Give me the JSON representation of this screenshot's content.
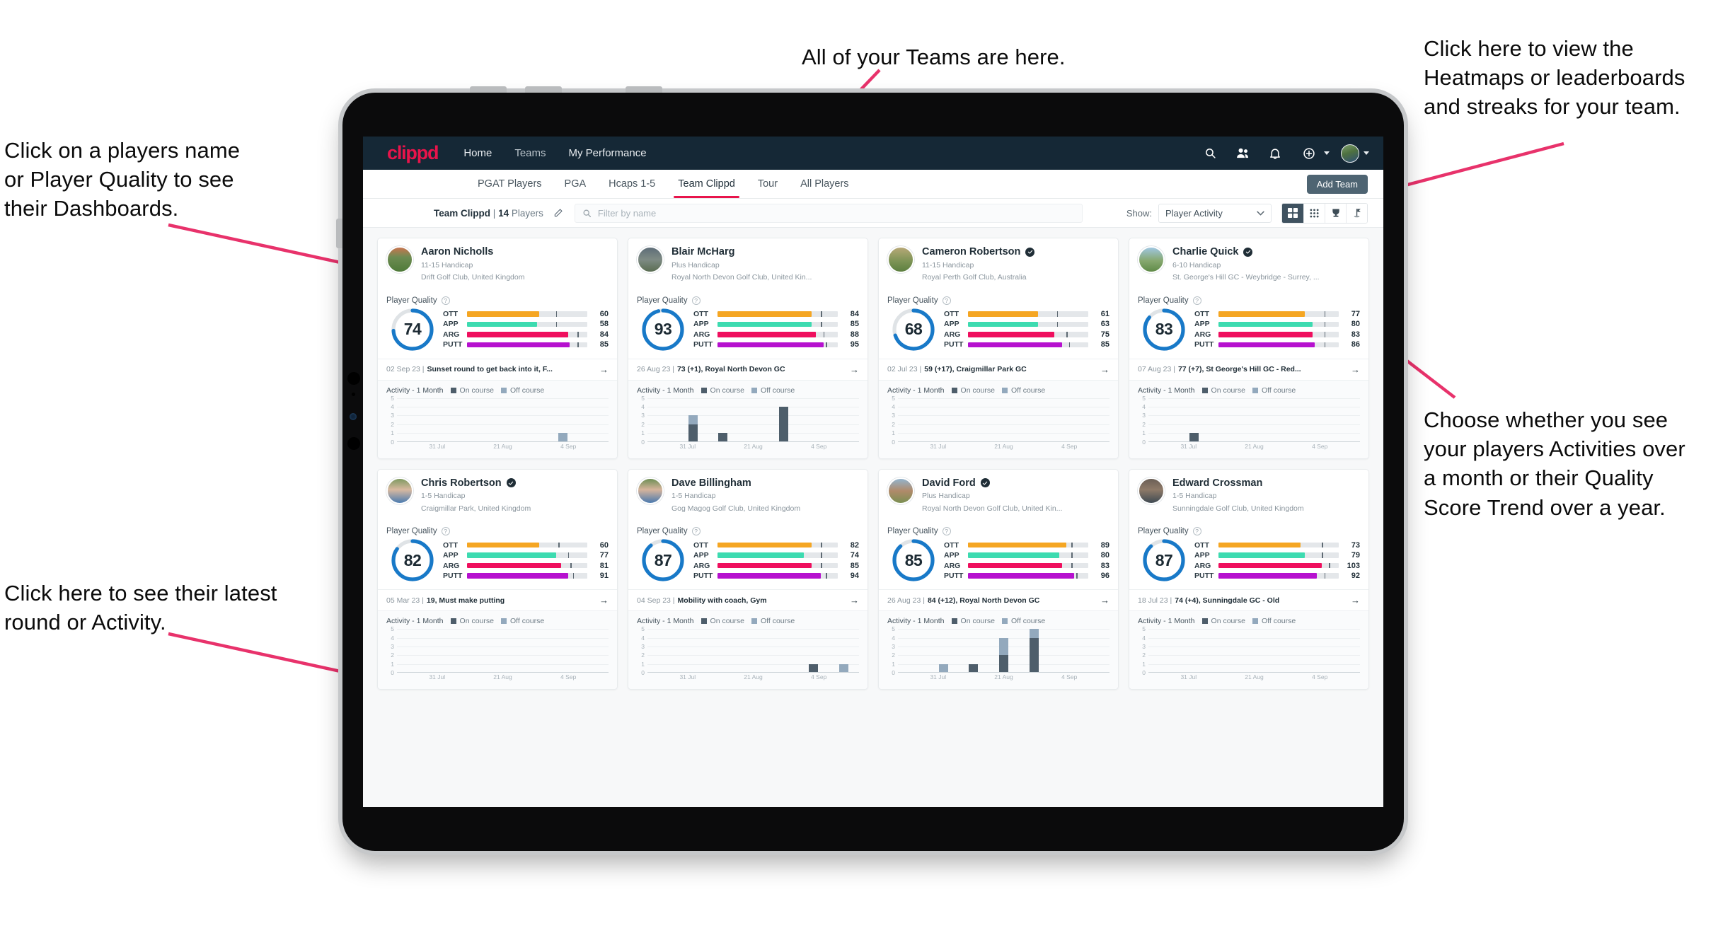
{
  "annotations": [
    {
      "id": "teams",
      "text": "All of your Teams are here."
    },
    {
      "id": "heatmaps",
      "text": "Click here to view the\nHeatmaps or leaderboards\nand streaks for your team."
    },
    {
      "id": "players-name",
      "text": "Click on a players name\nor Player Quality to see\ntheir Dashboards."
    },
    {
      "id": "activity-toggle",
      "text": "Choose whether you see\nyour players Activities over\na month or their Quality\nScore Trend over a year."
    },
    {
      "id": "latest-round",
      "text": "Click here to see their latest\nround or Activity."
    }
  ],
  "topnav": {
    "brand": "clippd",
    "links": [
      {
        "label": "Home",
        "active": true
      },
      {
        "label": "Teams",
        "active": false
      },
      {
        "label": "My Performance",
        "active": false
      }
    ],
    "icons": [
      "search-icon",
      "people-icon",
      "bell-icon",
      "plus-circle-icon",
      "avatar"
    ]
  },
  "subtabs": {
    "items": [
      {
        "label": "PGAT Players",
        "active": false
      },
      {
        "label": "PGA",
        "active": false
      },
      {
        "label": "Hcaps 1-5",
        "active": false
      },
      {
        "label": "Team Clippd",
        "active": true
      },
      {
        "label": "Tour",
        "active": false
      },
      {
        "label": "All Players",
        "active": false
      }
    ],
    "add_team_label": "Add Team"
  },
  "toolbar": {
    "team_name": "Team Clippd",
    "separator": "|",
    "player_count": "14",
    "players_word": "Players",
    "edit_icon": "pencil-icon",
    "search_placeholder": "Filter by name",
    "show_label": "Show:",
    "show_value": "Player Activity",
    "show_options": [
      "Player Activity",
      "Quality Score Trend"
    ],
    "views": [
      {
        "name": "grid-view",
        "icon": "grid-icon",
        "active": true
      },
      {
        "name": "compact-view",
        "icon": "dots-grid-icon",
        "active": false
      },
      {
        "name": "leaderboard-view",
        "icon": "trophy-icon",
        "active": false
      },
      {
        "name": "heatmap-view",
        "icon": "golf-flag-icon",
        "active": false
      }
    ]
  },
  "card_labels": {
    "quality_title": "Player Quality",
    "help_icon": "question-icon",
    "activity_title": "Activity - 1 Month",
    "legend_on": "On course",
    "legend_off": "Off course",
    "arrow_icon": "arrow-right-icon"
  },
  "colors": {
    "accent": "#e8144b",
    "navbar": "#152836",
    "ott": "#f5a623",
    "app": "#3ddbb0",
    "arg": "#ef0f5e",
    "putt": "#b611cf",
    "ring": "#1879c8",
    "ring_track": "#dfe3e6",
    "on_course": "#4e5e6b",
    "off_course": "#93a9bd"
  },
  "chart_data": {
    "type": "bar",
    "title": "Activity - 1 Month",
    "series_names": [
      "On course",
      "Off course"
    ],
    "categories": [
      "31 Jul",
      "21 Aug",
      "4 Sep"
    ],
    "ylim": [
      0,
      5
    ],
    "yticks": [
      0,
      1,
      2,
      3,
      4,
      5
    ],
    "xlabel": "",
    "ylabel": "",
    "grid": true,
    "legend_position": "top",
    "per_player": [
      {
        "player": "Aaron Nicholls",
        "bins": [
          [
            0,
            0
          ],
          [
            0,
            0
          ],
          [
            0,
            0
          ],
          [
            0,
            0
          ],
          [
            0,
            0
          ],
          [
            0,
            1
          ],
          [
            0,
            0
          ]
        ]
      },
      {
        "player": "Blair McHarg",
        "bins": [
          [
            0,
            0
          ],
          [
            2,
            1
          ],
          [
            1,
            0
          ],
          [
            0,
            0
          ],
          [
            4,
            0
          ],
          [
            0,
            0
          ],
          [
            0,
            0
          ]
        ]
      },
      {
        "player": "Cameron Robertson",
        "bins": [
          [
            0,
            0
          ],
          [
            0,
            0
          ],
          [
            0,
            0
          ],
          [
            0,
            0
          ],
          [
            0,
            0
          ],
          [
            0,
            0
          ],
          [
            0,
            0
          ]
        ]
      },
      {
        "player": "Charlie Quick",
        "bins": [
          [
            0,
            0
          ],
          [
            1,
            0
          ],
          [
            0,
            0
          ],
          [
            0,
            0
          ],
          [
            0,
            0
          ],
          [
            0,
            0
          ],
          [
            0,
            0
          ]
        ]
      },
      {
        "player": "Chris Robertson",
        "bins": [
          [
            0,
            0
          ],
          [
            0,
            0
          ],
          [
            0,
            0
          ],
          [
            0,
            0
          ],
          [
            0,
            0
          ],
          [
            0,
            0
          ],
          [
            0,
            0
          ]
        ]
      },
      {
        "player": "Dave Billingham",
        "bins": [
          [
            0,
            0
          ],
          [
            0,
            0
          ],
          [
            0,
            0
          ],
          [
            0,
            0
          ],
          [
            0,
            0
          ],
          [
            1,
            0
          ],
          [
            0,
            1
          ]
        ]
      },
      {
        "player": "David Ford",
        "bins": [
          [
            0,
            0
          ],
          [
            0,
            1
          ],
          [
            1,
            0
          ],
          [
            2,
            2
          ],
          [
            4,
            1
          ],
          [
            0,
            0
          ],
          [
            0,
            0
          ]
        ]
      },
      {
        "player": "Edward Crossman",
        "bins": [
          [
            0,
            0
          ],
          [
            0,
            0
          ],
          [
            0,
            0
          ],
          [
            0,
            0
          ],
          [
            0,
            0
          ],
          [
            0,
            0
          ],
          [
            0,
            0
          ]
        ]
      }
    ]
  },
  "players": [
    {
      "name": "Aaron Nicholls",
      "verified": false,
      "handicap": "11-15 Handicap",
      "club": "Drift Golf Club, United Kingdom",
      "quality": 74,
      "ring_pct": 74,
      "bars": [
        {
          "label": "OTT",
          "value": 60,
          "fill": 60,
          "tick": 74
        },
        {
          "label": "APP",
          "value": 58,
          "fill": 58,
          "tick": 74
        },
        {
          "label": "ARG",
          "value": 84,
          "fill": 84,
          "tick": 92
        },
        {
          "label": "PUTT",
          "value": 85,
          "fill": 85,
          "tick": 92
        }
      ],
      "latest_date": "02 Sep 23",
      "latest_text": "Sunset round to get back into it, F...",
      "avatar_bg": "linear-gradient(180deg,#c8754f 0%,#6d8c52 40%,#4f7a39 100%)"
    },
    {
      "name": "Blair McHarg",
      "verified": false,
      "handicap": "Plus Handicap",
      "club": "Royal North Devon Golf Club, United Kin...",
      "quality": 93,
      "ring_pct": 96,
      "bars": [
        {
          "label": "OTT",
          "value": 84,
          "fill": 78,
          "tick": 86
        },
        {
          "label": "APP",
          "value": 85,
          "fill": 78,
          "tick": 86
        },
        {
          "label": "ARG",
          "value": 88,
          "fill": 82,
          "tick": 88
        },
        {
          "label": "PUTT",
          "value": 95,
          "fill": 88,
          "tick": 90
        }
      ],
      "latest_date": "26 Aug 23",
      "latest_text": "73 (+1), Royal North Devon GC",
      "avatar_bg": "linear-gradient(180deg,#5e6d78 0%,#7e8b84 50%,#5a6d52 100%)"
    },
    {
      "name": "Cameron Robertson",
      "verified": true,
      "handicap": "11-15 Handicap",
      "club": "Royal Perth Golf Club, Australia",
      "quality": 68,
      "ring_pct": 70,
      "bars": [
        {
          "label": "OTT",
          "value": 61,
          "fill": 58,
          "tick": 74
        },
        {
          "label": "APP",
          "value": 63,
          "fill": 58,
          "tick": 74
        },
        {
          "label": "ARG",
          "value": 75,
          "fill": 72,
          "tick": 82
        },
        {
          "label": "PUTT",
          "value": 85,
          "fill": 78,
          "tick": 84
        }
      ],
      "latest_date": "02 Jul 23",
      "latest_text": "59 (+17), Craigmillar Park GC",
      "avatar_bg": "linear-gradient(180deg,#b7a877 0%,#7e9456 55%,#5c7f3f 100%)"
    },
    {
      "name": "Charlie Quick",
      "verified": true,
      "handicap": "6-10 Handicap",
      "club": "St. George's Hill GC - Weybridge - Surrey, ...",
      "quality": 83,
      "ring_pct": 86,
      "bars": [
        {
          "label": "OTT",
          "value": 77,
          "fill": 72,
          "tick": 88
        },
        {
          "label": "APP",
          "value": 80,
          "fill": 78,
          "tick": 88
        },
        {
          "label": "ARG",
          "value": 83,
          "fill": 78,
          "tick": 88
        },
        {
          "label": "PUTT",
          "value": 86,
          "fill": 80,
          "tick": 88
        }
      ],
      "latest_date": "07 Aug 23",
      "latest_text": "77 (+7), St George's Hill GC - Red...",
      "avatar_bg": "linear-gradient(180deg,#9fc6e0 0%,#86a86f 55%,#5f8a47 100%)"
    },
    {
      "name": "Chris Robertson",
      "verified": true,
      "handicap": "1-5 Handicap",
      "club": "Craigmillar Park, United Kingdom",
      "quality": 82,
      "ring_pct": 85,
      "bars": [
        {
          "label": "OTT",
          "value": 60,
          "fill": 60,
          "tick": 76
        },
        {
          "label": "APP",
          "value": 77,
          "fill": 74,
          "tick": 84
        },
        {
          "label": "ARG",
          "value": 81,
          "fill": 78,
          "tick": 86
        },
        {
          "label": "PUTT",
          "value": 91,
          "fill": 84,
          "tick": 88
        }
      ],
      "latest_date": "05 Mar 23",
      "latest_text": "19, Must make putting",
      "avatar_bg": "linear-gradient(180deg,#7f9a61 0%,#d8b9a0 45%,#4b7bb0 100%)"
    },
    {
      "name": "Dave Billingham",
      "verified": false,
      "handicap": "1-5 Handicap",
      "club": "Gog Magog Golf Club, United Kingdom",
      "quality": 87,
      "ring_pct": 89,
      "bars": [
        {
          "label": "OTT",
          "value": 82,
          "fill": 78,
          "tick": 86
        },
        {
          "label": "APP",
          "value": 74,
          "fill": 72,
          "tick": 86
        },
        {
          "label": "ARG",
          "value": 85,
          "fill": 78,
          "tick": 86
        },
        {
          "label": "PUTT",
          "value": 94,
          "fill": 86,
          "tick": 90
        }
      ],
      "latest_date": "04 Sep 23",
      "latest_text": "Mobility with coach, Gym",
      "avatar_bg": "linear-gradient(180deg,#6f8f55 0%,#d6b49c 45%,#4a79ae 100%)"
    },
    {
      "name": "David Ford",
      "verified": true,
      "handicap": "Plus Handicap",
      "club": "Royal North Devon Golf Club, United Kin...",
      "quality": 85,
      "ring_pct": 88,
      "bars": [
        {
          "label": "OTT",
          "value": 89,
          "fill": 82,
          "tick": 86
        },
        {
          "label": "APP",
          "value": 80,
          "fill": 76,
          "tick": 86
        },
        {
          "label": "ARG",
          "value": 83,
          "fill": 78,
          "tick": 86
        },
        {
          "label": "PUTT",
          "value": 96,
          "fill": 88,
          "tick": 90
        }
      ],
      "latest_date": "26 Aug 23",
      "latest_text": "84 (+12), Royal North Devon GC",
      "avatar_bg": "linear-gradient(180deg,#93b4cd 0%,#b08a6a 50%,#7a8f52 100%)"
    },
    {
      "name": "Edward Crossman",
      "verified": false,
      "handicap": "1-5 Handicap",
      "club": "Sunningdale Golf Club, United Kingdom",
      "quality": 87,
      "ring_pct": 88,
      "bars": [
        {
          "label": "OTT",
          "value": 73,
          "fill": 68,
          "tick": 86
        },
        {
          "label": "APP",
          "value": 79,
          "fill": 72,
          "tick": 86
        },
        {
          "label": "ARG",
          "value": 103,
          "fill": 86,
          "tick": 92
        },
        {
          "label": "PUTT",
          "value": 92,
          "fill": 82,
          "tick": 88
        }
      ],
      "latest_date": "18 Jul 23",
      "latest_text": "74 (+4), Sunningdale GC - Old",
      "avatar_bg": "linear-gradient(180deg,#6b5f56 0%,#8e7a68 45%,#3f4a53 100%)"
    }
  ]
}
